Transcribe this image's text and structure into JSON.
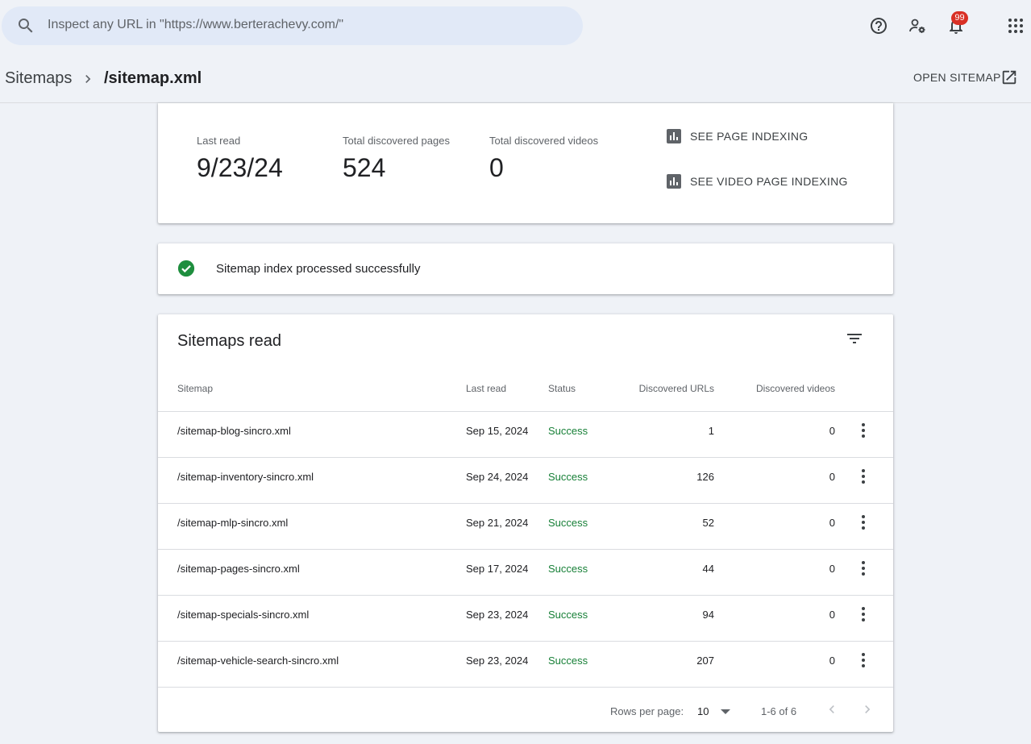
{
  "search": {
    "placeholder": "Inspect any URL in \"https://www.berterachevy.com/\"",
    "icon": "search-icon"
  },
  "header_icons": {
    "help": "help-icon",
    "admin": "manage-accounts-icon",
    "notifications": "bell-icon",
    "notification_count": "99",
    "apps": "apps-grid-icon"
  },
  "breadcrumb": {
    "root": "Sitemaps",
    "current": "/sitemap.xml",
    "open_label": "OPEN SITEMAP"
  },
  "stats": {
    "last_read_label": "Last read",
    "last_read_value": "9/23/24",
    "pages_label": "Total discovered pages",
    "pages_value": "524",
    "videos_label": "Total discovered videos",
    "videos_value": "0",
    "see_page_indexing": "SEE PAGE INDEXING",
    "see_video_indexing": "SEE VIDEO PAGE INDEXING"
  },
  "status": {
    "message": "Sitemap index processed successfully",
    "color": "#1e8e3e"
  },
  "table": {
    "title": "Sitemaps read",
    "columns": {
      "sitemap": "Sitemap",
      "last_read": "Last read",
      "status": "Status",
      "urls": "Discovered URLs",
      "videos": "Discovered videos"
    },
    "rows": [
      {
        "sitemap": "/sitemap-blog-sincro.xml",
        "last_read": "Sep 15, 2024",
        "status": "Success",
        "urls": "1",
        "videos": "0"
      },
      {
        "sitemap": "/sitemap-inventory-sincro.xml",
        "last_read": "Sep 24, 2024",
        "status": "Success",
        "urls": "126",
        "videos": "0"
      },
      {
        "sitemap": "/sitemap-mlp-sincro.xml",
        "last_read": "Sep 21, 2024",
        "status": "Success",
        "urls": "52",
        "videos": "0"
      },
      {
        "sitemap": "/sitemap-pages-sincro.xml",
        "last_read": "Sep 17, 2024",
        "status": "Success",
        "urls": "44",
        "videos": "0"
      },
      {
        "sitemap": "/sitemap-specials-sincro.xml",
        "last_read": "Sep 23, 2024",
        "status": "Success",
        "urls": "94",
        "videos": "0"
      },
      {
        "sitemap": "/sitemap-vehicle-search-sincro.xml",
        "last_read": "Sep 23, 2024",
        "status": "Success",
        "urls": "207",
        "videos": "0"
      }
    ],
    "footer": {
      "rows_per_page_label": "Rows per page:",
      "rows_per_page": "10",
      "range": "1-6 of 6"
    }
  }
}
